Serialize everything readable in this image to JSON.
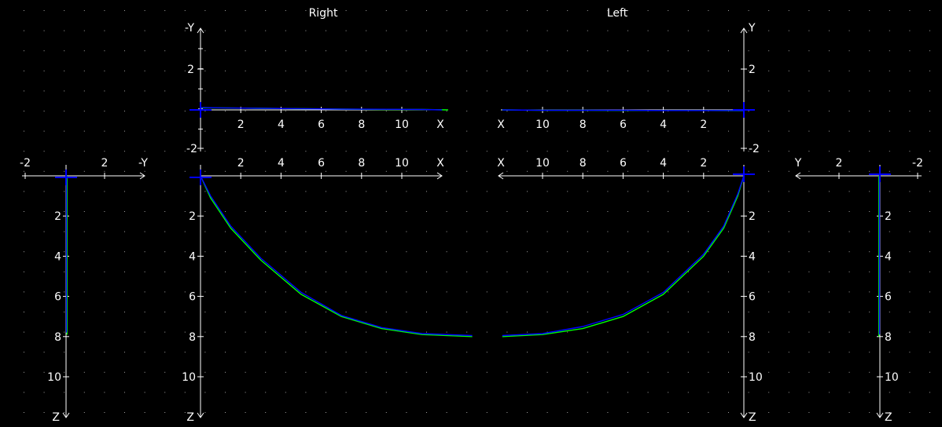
{
  "chart_data": {
    "type": "line",
    "panels": {
      "right_top": {
        "title": "Right",
        "x_axis_label": "X",
        "y_axis_label": "-Y",
        "x_ticks": [
          "2",
          "4",
          "6",
          "8",
          "10"
        ],
        "y_ticks": [
          "2",
          "-2"
        ],
        "xlim": [
          0,
          12
        ],
        "ylim": [
          -2,
          4
        ],
        "series": [
          {
            "color": "#00ff00",
            "x": [
              0,
              1,
              3,
              5,
              7,
              9,
              11,
              12.3
            ],
            "y": [
              0.1,
              0.1,
              0.08,
              0.06,
              0.04,
              0.02,
              0.02,
              0.0
            ]
          },
          {
            "color": "#0000ff",
            "x": [
              0,
              1,
              3,
              5,
              7,
              9,
              11,
              12
            ],
            "y": [
              0.12,
              0.1,
              0.08,
              0.06,
              0.04,
              0.03,
              0.02,
              0.0
            ]
          }
        ]
      },
      "left_top": {
        "title": "Left",
        "x_axis_label": "X",
        "y_axis_label": "Y",
        "x_ticks": [
          "10",
          "8",
          "6",
          "4",
          "2"
        ],
        "y_ticks": [
          "2",
          "-2"
        ],
        "xlim": [
          0,
          12
        ],
        "ylim": [
          -2,
          4
        ],
        "series": [
          {
            "color": "#00ff00",
            "x": [
              12,
              10,
              8,
              6,
              4,
              2,
              0
            ],
            "y": [
              0.0,
              -0.02,
              -0.02,
              -0.03,
              -0.03,
              -0.03,
              -0.04
            ]
          },
          {
            "color": "#0000ff",
            "x": [
              12,
              10,
              8,
              6,
              4,
              2,
              0
            ],
            "y": [
              0.0,
              -0.02,
              -0.02,
              -0.02,
              -0.03,
              -0.03,
              -0.03
            ]
          }
        ]
      },
      "right_bottom": {
        "x_axis_label": "X",
        "z_axis_label": "Z",
        "x_ticks": [
          "2",
          "4",
          "6",
          "8",
          "10"
        ],
        "z_ticks": [
          "2",
          "4",
          "6",
          "8",
          "10"
        ],
        "xlim": [
          0,
          12
        ],
        "zlim": [
          0,
          12
        ],
        "series": [
          {
            "color": "#00ff00",
            "x": [
              0,
              0.5,
              1.5,
              3,
              5,
              7,
              9,
              11,
              13.5
            ],
            "z": [
              0,
              1.1,
              2.6,
              4.2,
              5.9,
              7.0,
              7.6,
              7.9,
              8.0
            ]
          },
          {
            "color": "#0000ff",
            "x": [
              0,
              0.5,
              1.5,
              3,
              5,
              7,
              9,
              11,
              13.5
            ],
            "z": [
              0,
              1.0,
              2.5,
              4.1,
              5.8,
              6.95,
              7.55,
              7.85,
              7.95
            ]
          }
        ]
      },
      "left_bottom": {
        "x_axis_label": "X",
        "z_axis_label": "Z",
        "x_ticks": [
          "10",
          "8",
          "6",
          "4",
          "2"
        ],
        "z_ticks": [
          "2",
          "4",
          "6",
          "8",
          "10"
        ],
        "xlim": [
          0,
          12
        ],
        "zlim": [
          0,
          12
        ],
        "series": [
          {
            "color": "#00ff00",
            "x": [
              12,
              10,
              8,
              6,
              4,
              2,
              1,
              0.3,
              0
            ],
            "z": [
              8.0,
              7.9,
              7.6,
              7.0,
              5.9,
              4.0,
              2.6,
              1.0,
              0.0
            ]
          },
          {
            "color": "#0000ff",
            "x": [
              12,
              10,
              8,
              6,
              4,
              2,
              1,
              0.3,
              0
            ],
            "z": [
              7.95,
              7.85,
              7.5,
              6.9,
              5.8,
              3.9,
              2.5,
              0.9,
              0.0
            ]
          }
        ]
      },
      "side_right": {
        "y_axis_label": "-Y",
        "z_axis_label": "Z",
        "y_ticks": [
          "-2",
          "2"
        ],
        "z_ticks": [
          "2",
          "4",
          "6",
          "8",
          "10"
        ],
        "ylim": [
          -3,
          4
        ],
        "zlim": [
          0,
          12
        ],
        "series": [
          {
            "color": "#00ff00",
            "y": [
              0.05,
              0.05,
              0.05,
              0.05,
              0.05
            ],
            "z": [
              0,
              2,
              4,
              6,
              7.9
            ]
          },
          {
            "color": "#0000ff",
            "y": [
              0.02,
              0.02,
              0.02,
              0.02,
              0.02
            ],
            "z": [
              0,
              2,
              4,
              6,
              7.8
            ]
          }
        ]
      },
      "side_left": {
        "y_axis_label": "Y",
        "z_axis_label": "Z",
        "y_ticks": [
          "2",
          "-2"
        ],
        "z_ticks": [
          "2",
          "4",
          "6",
          "8",
          "10"
        ],
        "ylim": [
          -3,
          4
        ],
        "zlim": [
          0,
          12
        ],
        "series": [
          {
            "color": "#00ff00",
            "y": [
              0.05,
              0.05,
              0.05,
              0.05,
              0.05
            ],
            "z": [
              0,
              2,
              4,
              6,
              8.0
            ]
          },
          {
            "color": "#0000ff",
            "y": [
              0.02,
              0.02,
              0.02,
              0.02,
              0.02
            ],
            "z": [
              0,
              2,
              4,
              6,
              7.9
            ]
          }
        ]
      }
    },
    "grid": true,
    "colors": {
      "background": "#000000",
      "axis": "#ffffff",
      "grid_dot": "#a0a0a0",
      "marker": "#0000ff"
    }
  }
}
